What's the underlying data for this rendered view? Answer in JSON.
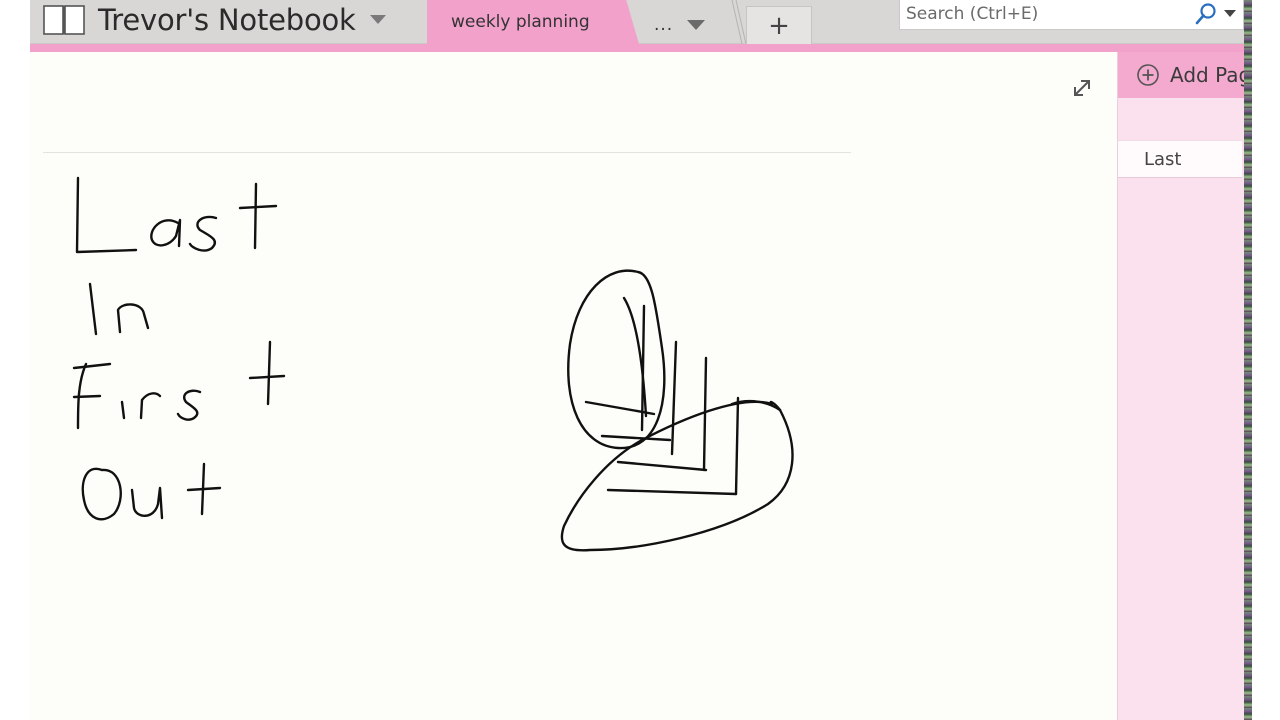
{
  "header": {
    "notebook_title": "Trevor's Notebook",
    "section_tab": "weekly planning",
    "more_tabs": "...",
    "add_tab": "+",
    "search_placeholder": "Search (Ctrl+E)"
  },
  "page_pane": {
    "add_page_label": "Add Page",
    "pages": [
      "Last"
    ]
  },
  "canvas": {
    "handwriting_lines": [
      "Last",
      "In",
      "First",
      "Out"
    ],
    "sketch": "hand-drawn stacked-item diagram"
  },
  "colors": {
    "section_accent": "#f2a1cb",
    "page_pane_bg": "#fbe1ee",
    "topbar_bg": "#d9d7d5",
    "ink": "#111111"
  },
  "icons": [
    "notebook-icon",
    "caret-down-icon",
    "search-icon",
    "expand-icon",
    "add-page-icon"
  ]
}
